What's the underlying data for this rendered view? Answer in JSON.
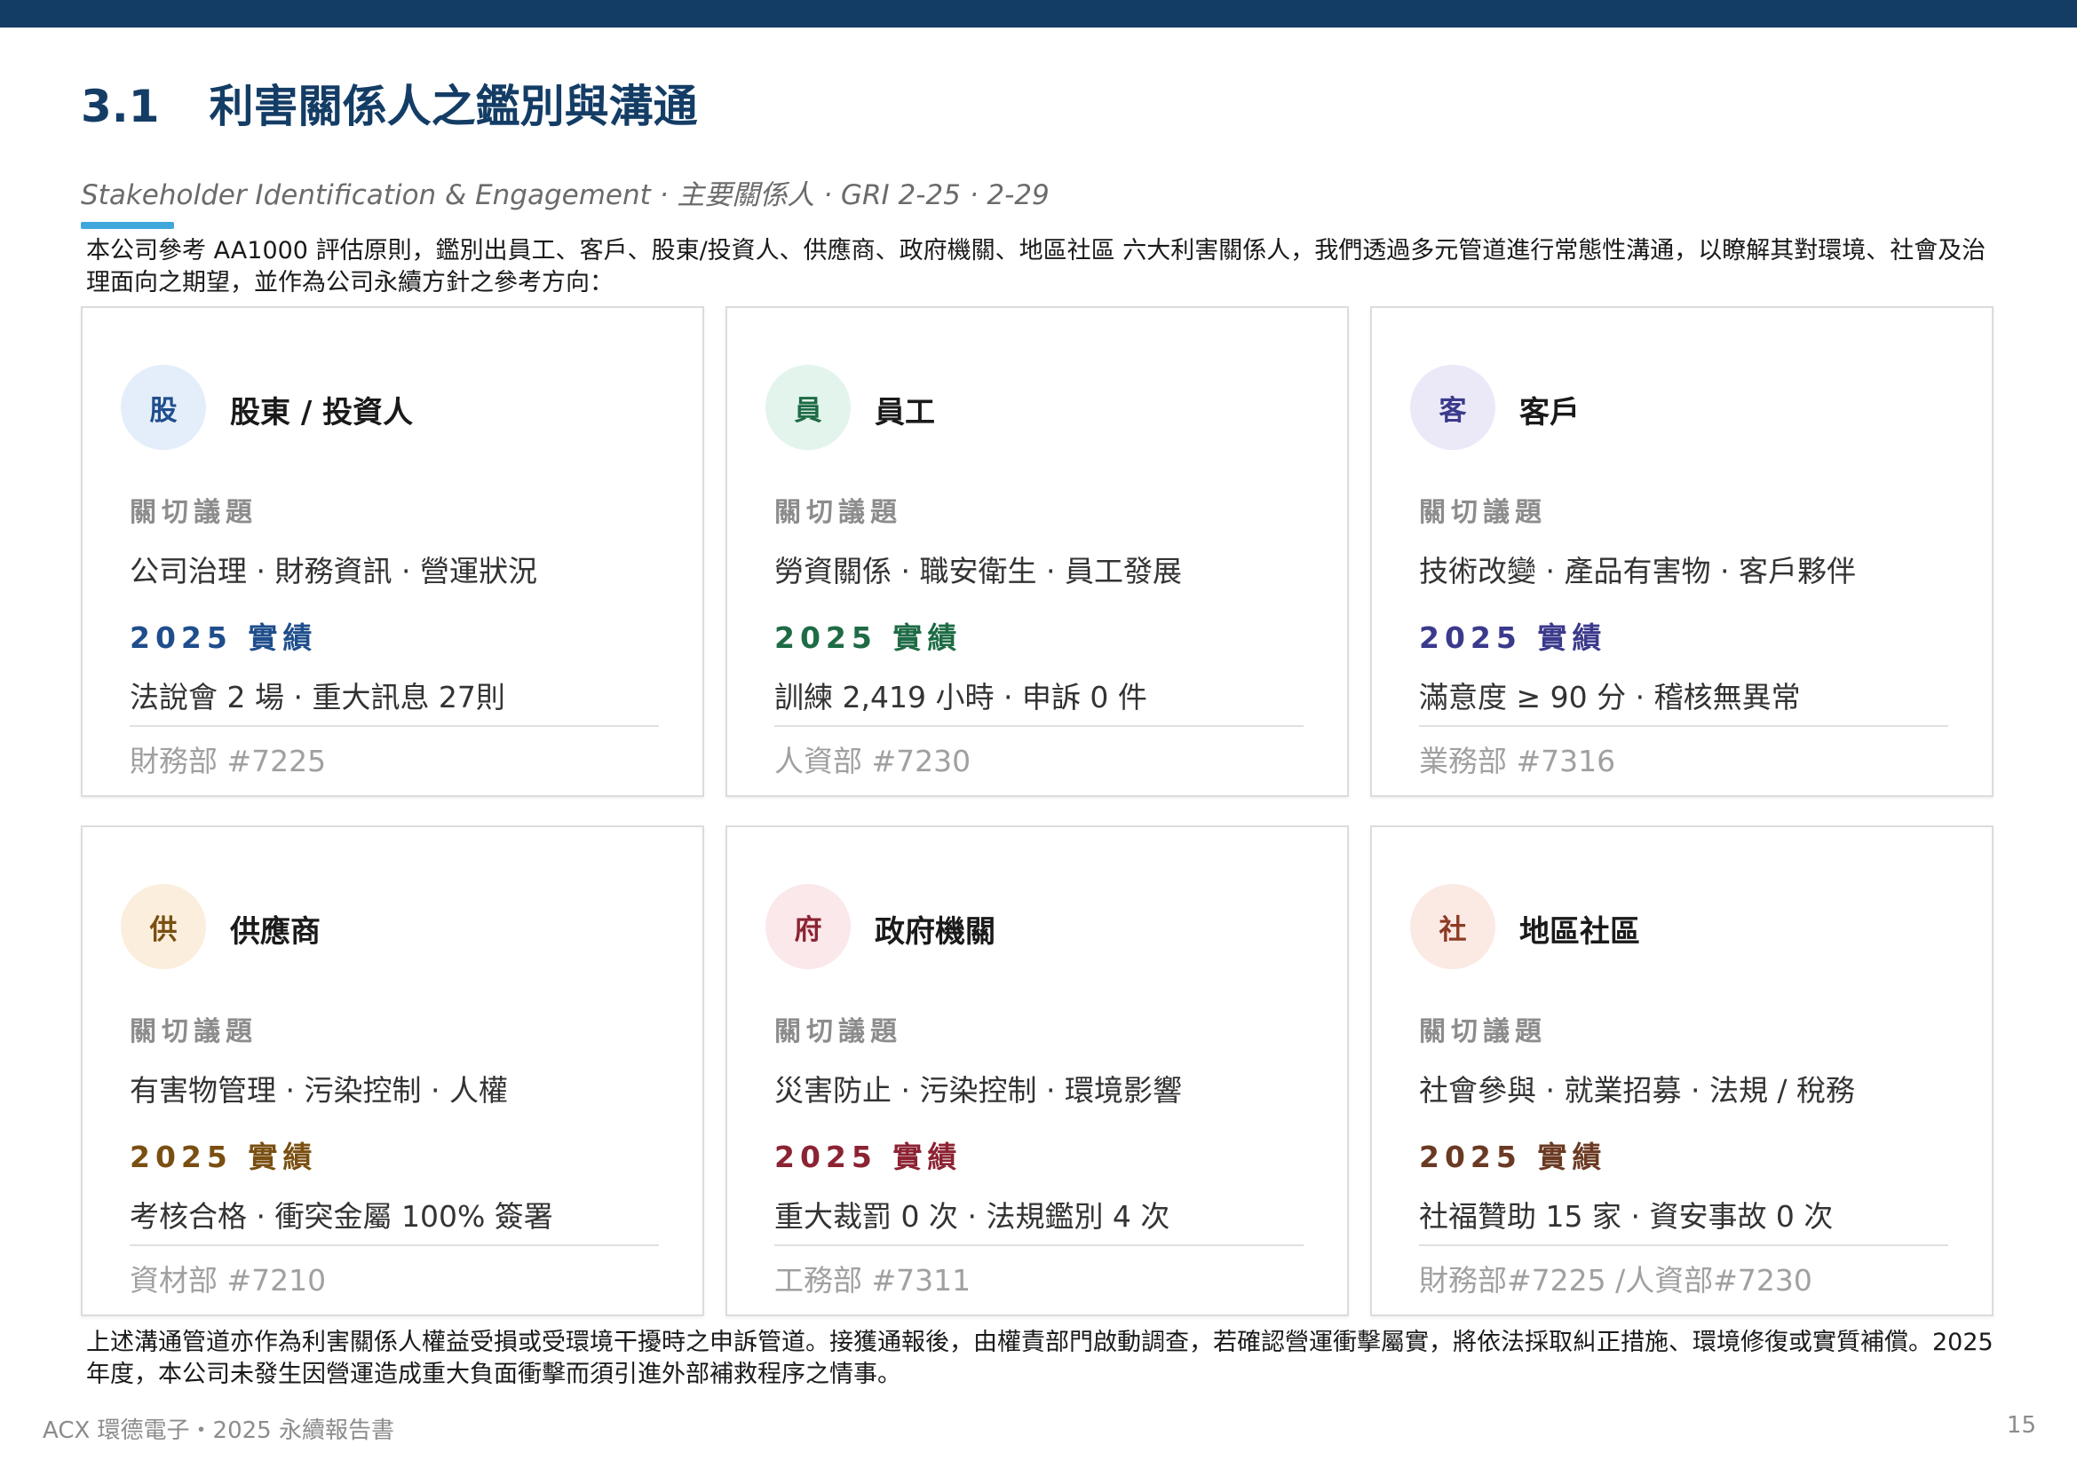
{
  "header": {
    "section_number": "3.1",
    "title": "利害關係人之鑑別與溝通",
    "subtitle": "Stakeholder Identification & Engagement · 主要關係人 · GRI 2-25 · 2-29"
  },
  "intro": "本公司參考 AA1000 評估原則，鑑別出員工、客戶、股東/投資人、供應商、政府機關、地區社區 六大利害關係人，我們透過多元管道進行常態性溝通，以瞭解其對環境、社會及治理面向之期望，並作為公司永續方針之參考方向：",
  "labels": {
    "concerns": "關切議題",
    "performance": "2025 實績"
  },
  "colors": {
    "top_bar": "#143d66",
    "title": "#143d66",
    "accent_line": "#3fa7dc"
  },
  "cards": [
    {
      "badge": "股",
      "name": "股東 / 投資人",
      "concerns": "公司治理 · 財務資訊 · 營運狀況",
      "performance": "法說會 2 場 · 重大訊息 27則",
      "contact": "財務部 #7225",
      "badge_bg": "#e4eefa",
      "badge_color": "#1f4e8c",
      "perf_color": "#1f4e8c"
    },
    {
      "badge": "員",
      "name": "員工",
      "concerns": "勞資關係 · 職安衛生 · 員工發展",
      "performance": "訓練 2,419 小時 · 申訴 0 件",
      "contact": "人資部 #7230",
      "badge_bg": "#e2f4ec",
      "badge_color": "#1e6b45",
      "perf_color": "#1e6b45"
    },
    {
      "badge": "客",
      "name": "客戶",
      "concerns": "技術改變 · 產品有害物 · 客戶夥伴",
      "performance": "滿意度 ≥ 90 分 · 稽核無異常",
      "contact": "業務部 #7316",
      "badge_bg": "#ebe9f8",
      "badge_color": "#3b3a8c",
      "perf_color": "#3b3a8c"
    },
    {
      "badge": "供",
      "name": "供應商",
      "concerns": "有害物管理 · 污染控制 · 人權",
      "performance": "考核合格 · 衝突金屬 100% 簽署",
      "contact": "資材部 #7210",
      "badge_bg": "#fbeedc",
      "badge_color": "#7a4f12",
      "perf_color": "#7a4f12"
    },
    {
      "badge": "府",
      "name": "政府機關",
      "concerns": "災害防止 · 污染控制 · 環境影響",
      "performance": "重大裁罰 0 次 · 法規鑑別 4 次",
      "contact": "工務部 #7311",
      "badge_bg": "#fbe8ea",
      "badge_color": "#8c2333",
      "perf_color": "#8c2333"
    },
    {
      "badge": "社",
      "name": "地區社區",
      "concerns": "社會參與 · 就業招募 · 法規 / 稅務",
      "performance": "社福贊助 15 家 · 資安事故 0 次",
      "contact": "財務部#7225 /人資部#7230",
      "badge_bg": "#fbe9e4",
      "badge_color": "#8c3a23",
      "perf_color": "#6b3a23"
    }
  ],
  "outro": "上述溝通管道亦作為利害關係人權益受損或受環境干擾時之申訴管道。接獲通報後，由權責部門啟動調查，若確認營運衝擊屬實，將依法採取糾正措施、環境修復或實質補償。2025 年度，本公司未發生因營運造成重大負面衝擊而須引進外部補救程序之情事。",
  "footer": {
    "left": "ACX 環德電子・2025 永續報告書",
    "page": "15"
  }
}
